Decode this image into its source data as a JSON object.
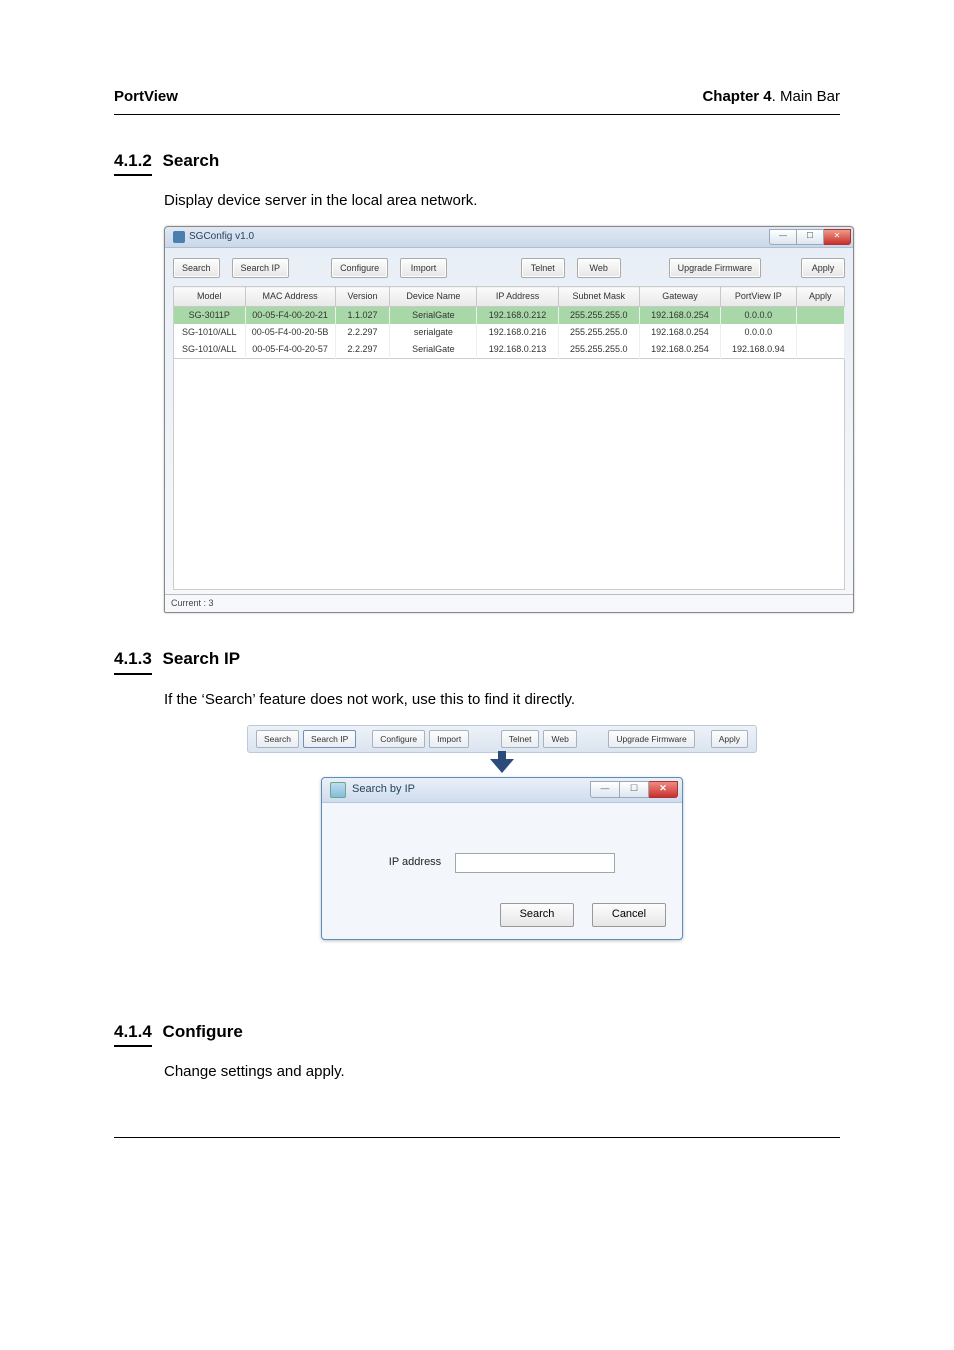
{
  "header": {
    "left": "PortView",
    "right_bold": "Chapter 4",
    "right_rest": ". Main Bar"
  },
  "sections": {
    "s412": {
      "num": "4.1.2",
      "title": "Search",
      "para": "Display device server in the local area network."
    },
    "s413": {
      "num": "4.1.3",
      "title": "Search IP",
      "para": "If the ‘Search’ feature does not work, use this to find it directly."
    },
    "s414": {
      "num": "4.1.4",
      "title": "Configure",
      "para": "Change settings and apply."
    }
  },
  "sgconfig": {
    "window_title": "SGConfig v1.0",
    "toolbar": {
      "search": "Search",
      "search_ip": "Search IP",
      "configure": "Configure",
      "import": "Import",
      "telnet": "Telnet",
      "web": "Web",
      "upgrade": "Upgrade Firmware",
      "apply": "Apply"
    },
    "columns": [
      "Model",
      "MAC Address",
      "Version",
      "Device Name",
      "IP Address",
      "Subnet Mask",
      "Gateway",
      "PortView IP",
      "Apply"
    ],
    "rows": [
      {
        "model": "SG-3011P",
        "mac": "00-05-F4-00-20-21",
        "ver": "1.1.027",
        "name": "SerialGate",
        "ip": "192.168.0.212",
        "mask": "255.255.255.0",
        "gw": "192.168.0.254",
        "pv": "0.0.0.0",
        "apply": "",
        "sel": true
      },
      {
        "model": "SG-1010/ALL",
        "mac": "00-05-F4-00-20-5B",
        "ver": "2.2.297",
        "name": "serialgate",
        "ip": "192.168.0.216",
        "mask": "255.255.255.0",
        "gw": "192.168.0.254",
        "pv": "0.0.0.0",
        "apply": ""
      },
      {
        "model": "SG-1010/ALL",
        "mac": "00-05-F4-00-20-57",
        "ver": "2.2.297",
        "name": "SerialGate",
        "ip": "192.168.0.213",
        "mask": "255.255.255.0",
        "gw": "192.168.0.254",
        "pv": "192.168.0.94",
        "apply": ""
      }
    ],
    "status": "Current : 3",
    "aero": {
      "min": "—",
      "max": "☐",
      "close": "✕"
    }
  },
  "searchip": {
    "bar": {
      "search": "Search",
      "search_ip": "Search IP",
      "configure": "Configure",
      "import": "Import",
      "telnet": "Telnet",
      "web": "Web",
      "upgrade": "Upgrade Firmware",
      "apply": "Apply"
    },
    "dialog": {
      "title": "Search by IP",
      "label": "IP address",
      "value": "",
      "search_btn": "Search",
      "cancel_btn": "Cancel",
      "aero": {
        "min": "—",
        "max": "☐",
        "close": "✕"
      }
    }
  }
}
